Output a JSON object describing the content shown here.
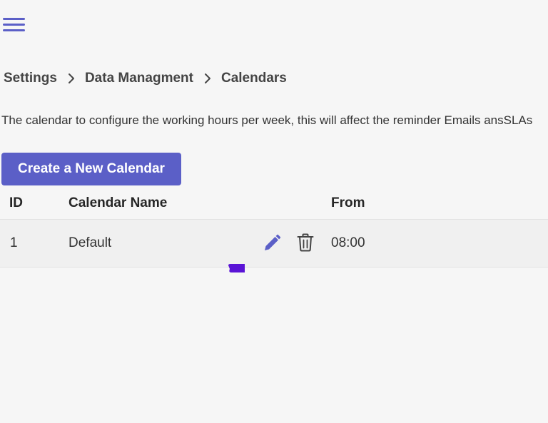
{
  "nav": {
    "menu_icon": "hamburger-icon"
  },
  "breadcrumb": {
    "items": [
      "Settings",
      "Data Managment",
      "Calendars"
    ],
    "separator_icon": "chevron-right-icon"
  },
  "description": "The calendar to configure the working hours per week, this will affect the reminder Emails ansSLAs",
  "create_button": {
    "label": "Create a New Calendar"
  },
  "table": {
    "columns": [
      "ID",
      "Calendar Name",
      "From"
    ],
    "rows": [
      {
        "id": "1",
        "name": "Default",
        "from": "08:00",
        "edit_icon": "pencil-icon",
        "delete_icon": "trash-icon"
      }
    ]
  },
  "colors": {
    "accent": "#5b5fc7",
    "background": "#f6f6f6",
    "row_background": "#f0f0f0",
    "cursor": "#5a14d6"
  }
}
